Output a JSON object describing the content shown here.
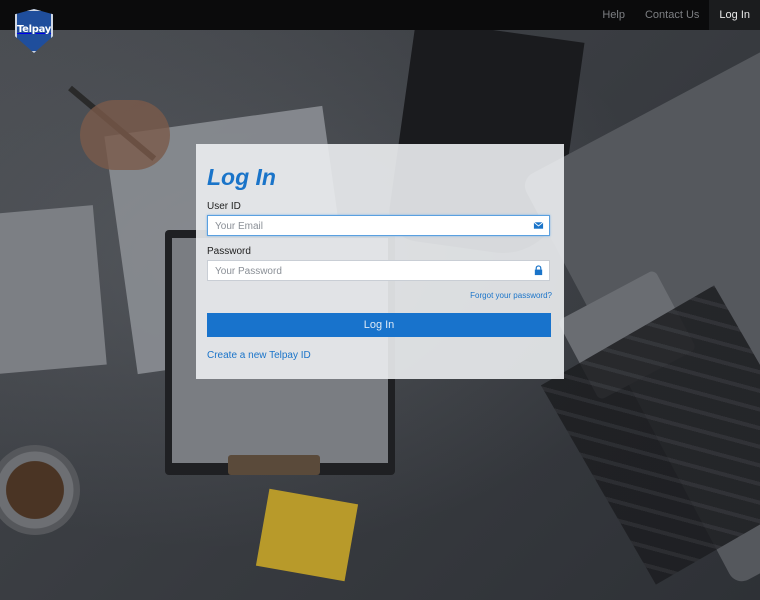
{
  "brand": {
    "logo_text": "Telpay"
  },
  "nav": {
    "items": [
      {
        "label": "Help"
      },
      {
        "label": "Contact Us"
      },
      {
        "label": "Log In",
        "active": true
      }
    ]
  },
  "login": {
    "title": "Log In",
    "user_id_label": "User ID",
    "email_placeholder": "Your Email",
    "password_label": "Password",
    "password_placeholder": "Your Password",
    "forgot_link": "Forgot your password?",
    "submit_label": "Log In",
    "create_link": "Create a new Telpay ID"
  },
  "icons": {
    "email_field": "envelope-icon",
    "password_field": "lock-icon"
  },
  "colors": {
    "accent": "#1873cc",
    "topbar": "#0b0b0c",
    "link": "#1a74c9"
  }
}
